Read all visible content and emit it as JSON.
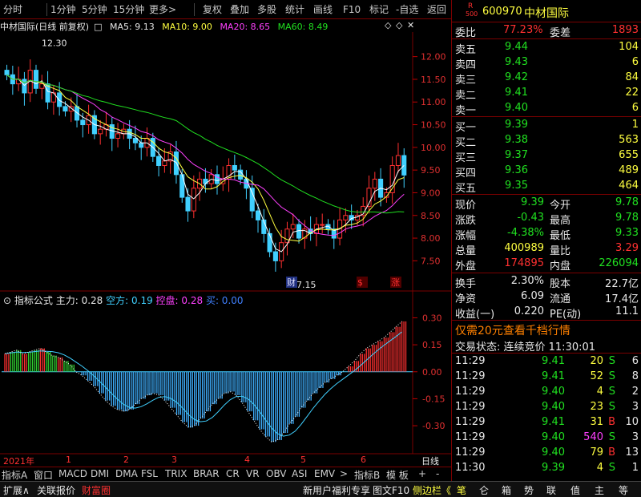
{
  "toolbar": {
    "items": [
      "分时",
      "1分钟",
      "5分钟",
      "15分钟",
      "更多",
      "复权",
      "叠加",
      "多股",
      "统计",
      "画线",
      "F10",
      "标记",
      "-自选",
      "返回"
    ]
  },
  "kline": {
    "title": "中材国际(日线 前复权)",
    "ma5": "MA5: 9.13",
    "ma10": "MA10: 9.00",
    "ma20": "MA20: 8.65",
    "ma60": "MA60: 8.49",
    "high_label": "12.30",
    "low_label": "7.15",
    "price_ticks": [
      "12.00",
      "11.50",
      "11.00",
      "10.50",
      "10.00",
      "9.50",
      "9.00",
      "8.50",
      "8.00",
      "7.50"
    ],
    "markers": [
      "财",
      "$",
      "涨"
    ]
  },
  "indicator": {
    "title": "指标公式",
    "main": "主力: 0.28",
    "kong": "空方: 0.19",
    "kongpan": "控盘: 0.28",
    "buy": "买: 0.00",
    "ticks": [
      "0.30",
      "0.15",
      "0.00",
      "-0.15",
      "-0.30"
    ]
  },
  "xaxis": {
    "year": "2021年",
    "months": [
      "1",
      "2",
      "3",
      "4",
      "5",
      "6"
    ],
    "period": "日线"
  },
  "indicator_tabs": [
    "指标A",
    "窗口",
    "MACD",
    "DMI",
    "DMA",
    "FSL",
    "TRIX",
    "BRAR",
    "CR",
    "VR",
    "OBV",
    "ASI",
    "EMV",
    "指标B",
    "模 板",
    "+",
    "-"
  ],
  "bottom": {
    "left": [
      "扩展∧",
      "关联报价",
      "财富圈"
    ],
    "center": [
      "新用户福利专享",
      "图文F10",
      "侧边栏《"
    ],
    "right": [
      "笔",
      "仑",
      "箱",
      "势",
      "联",
      "值",
      "主",
      "等"
    ]
  },
  "stock": {
    "code": "600970",
    "name": "中材国际",
    "r_badge": "R",
    "badge_num": "500",
    "webi_label": "委比",
    "webi_value": "77.23%",
    "weicha_label": "委差",
    "weicha_value": "1893"
  },
  "asks": [
    {
      "label": "卖五",
      "price": "9.44",
      "vol": "104"
    },
    {
      "label": "卖四",
      "price": "9.43",
      "vol": "6"
    },
    {
      "label": "卖三",
      "price": "9.42",
      "vol": "84"
    },
    {
      "label": "卖二",
      "price": "9.41",
      "vol": "22"
    },
    {
      "label": "卖一",
      "price": "9.40",
      "vol": "6"
    }
  ],
  "bids": [
    {
      "label": "买一",
      "price": "9.39",
      "vol": "1"
    },
    {
      "label": "买二",
      "price": "9.38",
      "vol": "563"
    },
    {
      "label": "买三",
      "price": "9.37",
      "vol": "655"
    },
    {
      "label": "买四",
      "price": "9.36",
      "vol": "489"
    },
    {
      "label": "买五",
      "price": "9.35",
      "vol": "464"
    }
  ],
  "quote": [
    {
      "l1": "现价",
      "v1": "9.39",
      "l2": "今开",
      "v2": "9.78"
    },
    {
      "l1": "涨跌",
      "v1": "-0.43",
      "l2": "最高",
      "v2": "9.78"
    },
    {
      "l1": "涨幅",
      "v1": "-4.38%",
      "l2": "最低",
      "v2": "9.33"
    },
    {
      "l1": "总量",
      "v1": "400989",
      "l2": "量比",
      "v2": "3.29"
    },
    {
      "l1": "外盘",
      "v1": "174895",
      "l2": "内盘",
      "v2": "226094"
    }
  ],
  "fund": [
    {
      "l1": "换手",
      "v1": "2.30%",
      "l2": "股本",
      "v2": "22.7亿"
    },
    {
      "l1": "净资",
      "v1": "6.09",
      "l2": "流通",
      "v2": "17.4亿"
    },
    {
      "l1": "收益(一)",
      "v1": "0.220",
      "l2": "PE(动)",
      "v2": "11.1"
    }
  ],
  "promo": "仅需20元查看千档行情",
  "trade_status": "交易状态: 连续竞价 11:30:01",
  "ticks": [
    {
      "t": "11:29",
      "p": "9.41",
      "v": "20",
      "bs": "S",
      "n": "6"
    },
    {
      "t": "11:29",
      "p": "9.41",
      "v": "52",
      "bs": "S",
      "n": "8"
    },
    {
      "t": "11:29",
      "p": "9.40",
      "v": "4",
      "bs": "S",
      "n": "2"
    },
    {
      "t": "11:29",
      "p": "9.40",
      "v": "23",
      "bs": "S",
      "n": "3"
    },
    {
      "t": "11:29",
      "p": "9.41",
      "v": "31",
      "bs": "B",
      "n": "10"
    },
    {
      "t": "11:29",
      "p": "9.40",
      "v": "540",
      "bs": "S",
      "n": "3"
    },
    {
      "t": "11:29",
      "p": "9.40",
      "v": "79",
      "bs": "B",
      "n": "13"
    },
    {
      "t": "11:30",
      "p": "9.39",
      "v": "4",
      "bs": "S",
      "n": "1"
    }
  ],
  "chart_data": {
    "type": "candlestick",
    "price_range": [
      7.1,
      12.4
    ],
    "close_approx": [
      11.6,
      11.4,
      11.5,
      11.2,
      11.7,
      11.3,
      11.4,
      11.0,
      11.2,
      10.9,
      10.8,
      10.9,
      10.6,
      10.5,
      10.7,
      10.3,
      10.4,
      10.5,
      10.2,
      10.3,
      10.4,
      10.2,
      10.1,
      10.0,
      10.2,
      9.8,
      9.6,
      9.7,
      9.9,
      9.4,
      8.9,
      8.6,
      9.1,
      9.3,
      9.2,
      9.4,
      9.2,
      9.3,
      9.6,
      9.5,
      9.3,
      9.1,
      8.6,
      8.4,
      8.1,
      7.7,
      7.5,
      7.9,
      8.2,
      8.3,
      8.0,
      8.2,
      8.1,
      8.3,
      8.3,
      8.2,
      8.0,
      8.4,
      8.5,
      8.4,
      8.5,
      8.7,
      9.1,
      9.3,
      8.9,
      9.0,
      9.6,
      9.82,
      9.39
    ],
    "indicator_values": [
      0.1,
      0.11,
      0.12,
      0.1,
      0.11,
      0.12,
      0.13,
      0.11,
      0.09,
      0.08,
      0.06,
      0.04,
      0.0,
      -0.02,
      -0.05,
      -0.08,
      -0.12,
      -0.16,
      -0.19,
      -0.21,
      -0.22,
      -0.21,
      -0.18,
      -0.15,
      -0.13,
      -0.12,
      -0.13,
      -0.16,
      -0.2,
      -0.24,
      -0.28,
      -0.31,
      -0.3,
      -0.26,
      -0.22,
      -0.18,
      -0.15,
      -0.12,
      -0.11,
      -0.13,
      -0.17,
      -0.22,
      -0.27,
      -0.32,
      -0.36,
      -0.39,
      -0.38,
      -0.34,
      -0.29,
      -0.25,
      -0.2,
      -0.16,
      -0.12,
      -0.09,
      -0.06,
      -0.04,
      -0.02,
      0.0,
      0.03,
      0.06,
      0.1,
      0.13,
      0.15,
      0.17,
      0.19,
      0.22,
      0.25,
      0.28
    ]
  }
}
